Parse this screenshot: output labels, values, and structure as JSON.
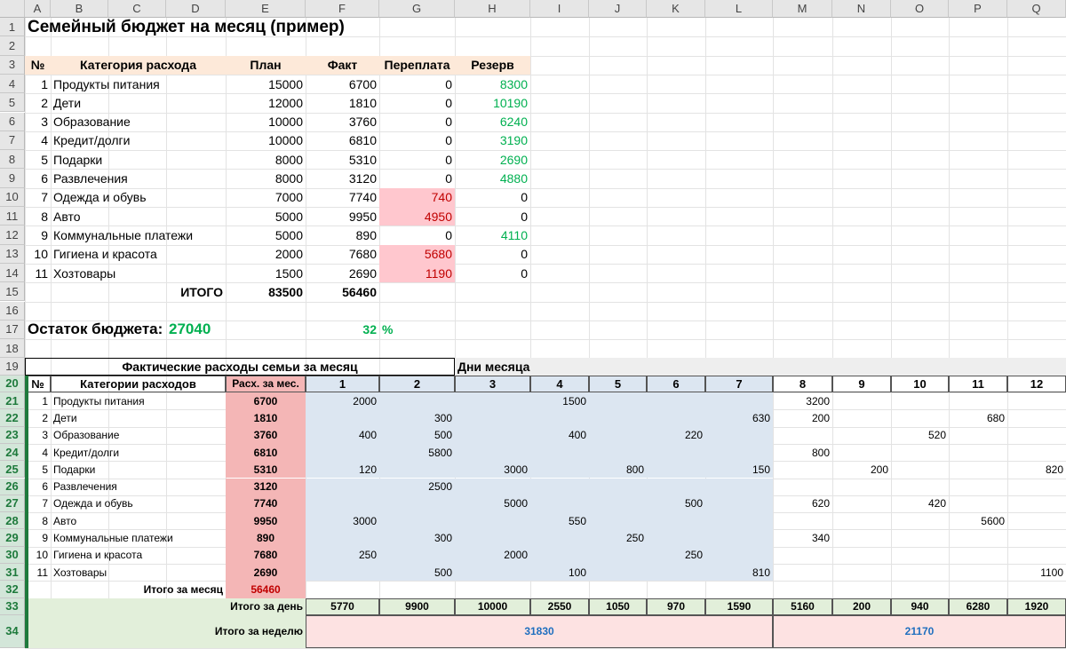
{
  "columns": [
    "A",
    "B",
    "C",
    "D",
    "E",
    "F",
    "G",
    "H",
    "I",
    "J",
    "K",
    "L",
    "M",
    "N",
    "O",
    "P",
    "Q"
  ],
  "row_numbers": [
    "1",
    "2",
    "3",
    "4",
    "5",
    "6",
    "7",
    "8",
    "9",
    "10",
    "11",
    "12",
    "13",
    "14",
    "15",
    "16",
    "17",
    "18",
    "19",
    "20",
    "21",
    "22",
    "23",
    "24",
    "25",
    "26",
    "27",
    "28",
    "29",
    "30",
    "31",
    "32",
    "33",
    "34"
  ],
  "title": "Семейный бюджет на месяц (пример)",
  "budget_table": {
    "headers": [
      "№",
      "Категория расхода",
      "План",
      "Факт",
      "Переплата",
      "Резерв"
    ],
    "rows": [
      [
        "1",
        "Продукты питания",
        "15000",
        "6700",
        "0",
        "8300"
      ],
      [
        "2",
        "Дети",
        "12000",
        "1810",
        "0",
        "10190"
      ],
      [
        "3",
        "Образование",
        "10000",
        "3760",
        "0",
        "6240"
      ],
      [
        "4",
        "Кредит/долги",
        "10000",
        "6810",
        "0",
        "3190"
      ],
      [
        "5",
        "Подарки",
        "8000",
        "5310",
        "0",
        "2690"
      ],
      [
        "6",
        "Развлечения",
        "8000",
        "3120",
        "0",
        "4880"
      ],
      [
        "7",
        "Одежда и обувь",
        "7000",
        "7740",
        "740",
        "0"
      ],
      [
        "8",
        "Авто",
        "5000",
        "9950",
        "4950",
        "0"
      ],
      [
        "9",
        "Коммунальные платежи",
        "5000",
        "890",
        "0",
        "4110"
      ],
      [
        "10",
        "Гигиена и красота",
        "2000",
        "7680",
        "5680",
        "0"
      ],
      [
        "11",
        "Хозтовары",
        "1500",
        "2690",
        "1190",
        "0"
      ]
    ],
    "total_label": "ИТОГО",
    "total_plan": "83500",
    "total_fact": "56460"
  },
  "balance": {
    "label": "Остаток бюджета:",
    "value": "27040",
    "percent": "32",
    "percent_sign": "%"
  },
  "daily": {
    "title": "Фактические расходы семьи за месяц",
    "days_title": "Дни месяца",
    "headers": [
      "№",
      "Категории расходов",
      "Расх. за мес."
    ],
    "days": [
      "1",
      "2",
      "3",
      "4",
      "5",
      "6",
      "7",
      "8",
      "9",
      "10",
      "11",
      "12"
    ],
    "rows": [
      {
        "n": "1",
        "name": "Продукты питания",
        "total": "6700",
        "d": [
          "2000",
          "",
          "",
          "1500",
          "",
          "",
          "",
          "3200",
          "",
          "",
          "",
          ""
        ]
      },
      {
        "n": "2",
        "name": "Дети",
        "total": "1810",
        "d": [
          "",
          "300",
          "",
          "",
          "",
          "",
          "630",
          "200",
          "",
          "",
          "680",
          ""
        ]
      },
      {
        "n": "3",
        "name": "Образование",
        "total": "3760",
        "d": [
          "400",
          "500",
          "",
          "400",
          "",
          "220",
          "",
          "",
          "",
          "520",
          "",
          ""
        ]
      },
      {
        "n": "4",
        "name": "Кредит/долги",
        "total": "6810",
        "d": [
          "",
          "5800",
          "",
          "",
          "",
          "",
          "",
          "800",
          "",
          "",
          "",
          ""
        ]
      },
      {
        "n": "5",
        "name": "Подарки",
        "total": "5310",
        "d": [
          "120",
          "",
          "3000",
          "",
          "800",
          "",
          "150",
          "",
          "200",
          "",
          "",
          "820"
        ]
      },
      {
        "n": "6",
        "name": "Развлечения",
        "total": "3120",
        "d": [
          "",
          "2500",
          "",
          "",
          "",
          "",
          "",
          "",
          "",
          "",
          "",
          ""
        ]
      },
      {
        "n": "7",
        "name": "Одежда и обувь",
        "total": "7740",
        "d": [
          "",
          "",
          "5000",
          "",
          "",
          "500",
          "",
          "620",
          "",
          "420",
          "",
          ""
        ]
      },
      {
        "n": "8",
        "name": "Авто",
        "total": "9950",
        "d": [
          "3000",
          "",
          "",
          "550",
          "",
          "",
          "",
          "",
          "",
          "",
          "5600",
          ""
        ]
      },
      {
        "n": "9",
        "name": "Коммунальные платежи",
        "total": "890",
        "d": [
          "",
          "300",
          "",
          "",
          "250",
          "",
          "",
          "340",
          "",
          "",
          "",
          ""
        ]
      },
      {
        "n": "10",
        "name": "Гигиена и красота",
        "total": "7680",
        "d": [
          "250",
          "",
          "2000",
          "",
          "",
          "250",
          "",
          "",
          "",
          "",
          "",
          ""
        ]
      },
      {
        "n": "11",
        "name": "Хозтовары",
        "total": "2690",
        "d": [
          "",
          "500",
          "",
          "100",
          "",
          "",
          "810",
          "",
          "",
          "",
          "",
          "1100"
        ]
      }
    ],
    "month_total_label": "Итого за месяц",
    "month_total": "56460",
    "day_total_label": "Итого за день",
    "day_totals": [
      "5770",
      "9900",
      "10000",
      "2550",
      "1050",
      "970",
      "1590",
      "5160",
      "200",
      "940",
      "6280",
      "1920"
    ],
    "week_total_label": "Итого за неделю",
    "week_totals": [
      "31830",
      "21170"
    ]
  },
  "colors": {
    "header_fill": "#fde9d9",
    "positive_green": "#00b050",
    "overpay_fill": "#ffc7ce",
    "overpay_text": "#c00000",
    "month_total_fill": "#f4b6b6",
    "days_fill": "#dce6f1",
    "week_fill": "#fde2e2",
    "week_text": "#1f6fbf",
    "summary_fill": "#e2efda",
    "selection_green": "#1e7a3c"
  }
}
